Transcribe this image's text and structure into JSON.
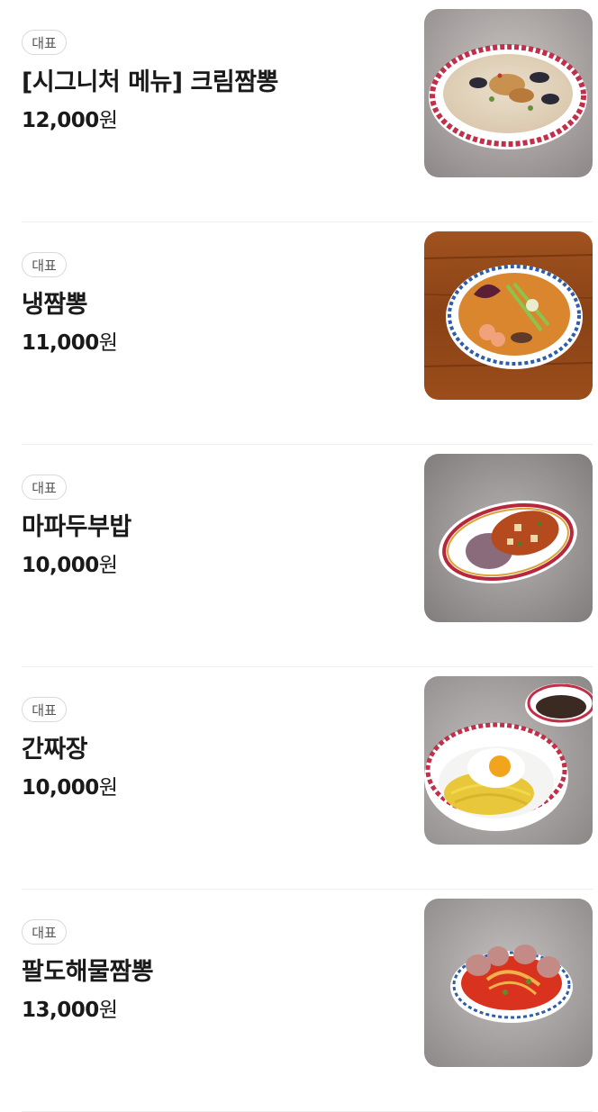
{
  "menu": {
    "items": [
      {
        "badge": "대표",
        "name": "[시그니처 메뉴] 크림짬뽕",
        "price": "12,000",
        "currency": "원",
        "image": "cream-jjamppong-photo"
      },
      {
        "badge": "대표",
        "name": "냉짬뽕",
        "price": "11,000",
        "currency": "원",
        "image": "cold-jjamppong-photo"
      },
      {
        "badge": "대표",
        "name": "마파두부밥",
        "price": "10,000",
        "currency": "원",
        "image": "mapo-tofu-rice-photo"
      },
      {
        "badge": "대표",
        "name": "간짜장",
        "price": "10,000",
        "currency": "원",
        "image": "ganjjajang-photo"
      },
      {
        "badge": "대표",
        "name": "팔도해물짬뽕",
        "price": "13,000",
        "currency": "원",
        "image": "seafood-jjamppong-photo"
      }
    ]
  },
  "colors": {
    "text": "#1a1a1a",
    "badge_border": "#d9d9d9",
    "divider": "#eeeeee"
  }
}
